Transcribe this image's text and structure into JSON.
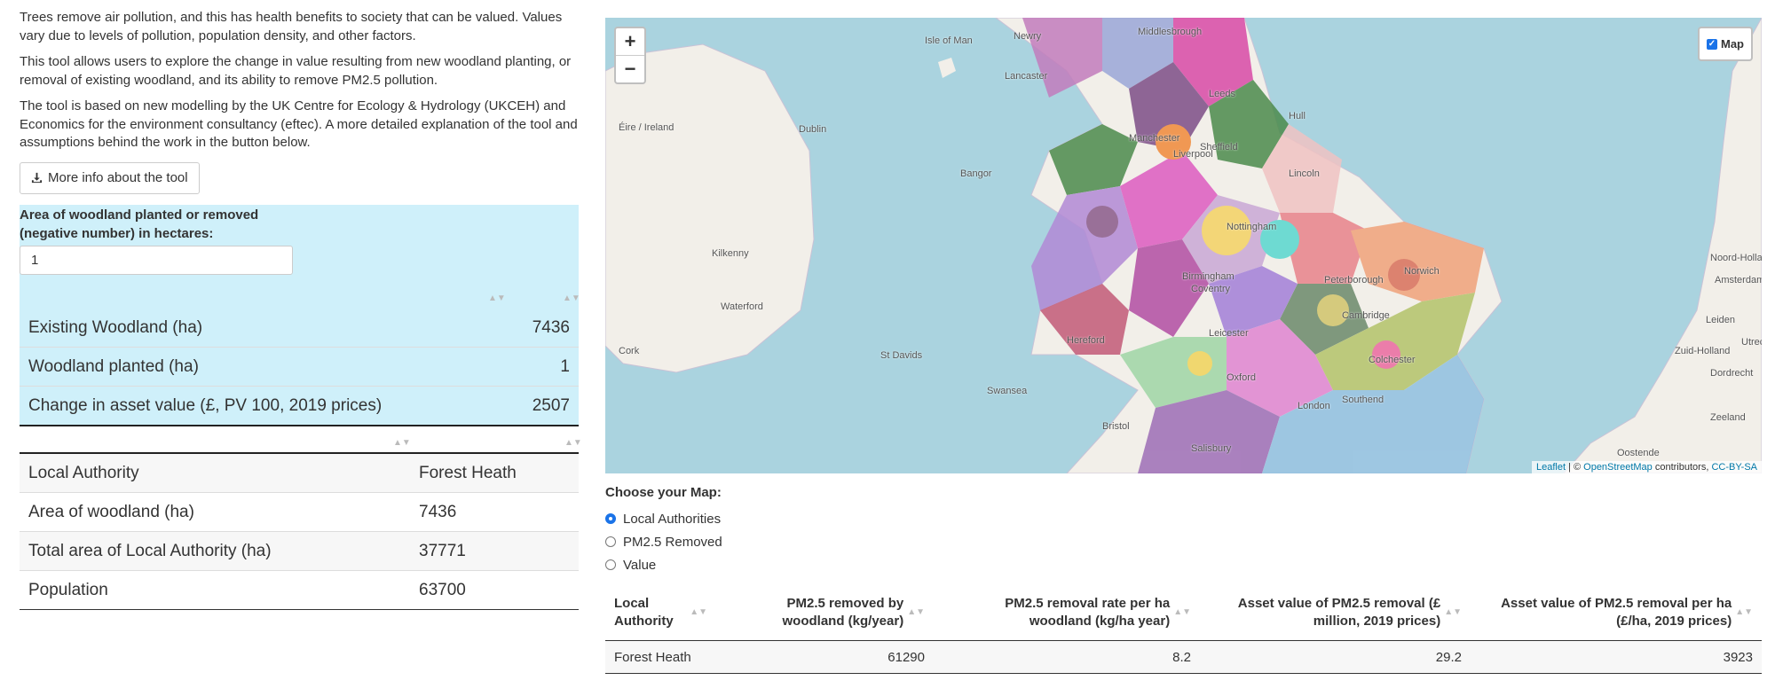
{
  "intro": {
    "p1": "Trees remove air pollution, and this has health benefits to society that can be valued. Values vary due to levels of pollution, population density, and other factors.",
    "p2": "This tool allows users to explore the change in value resulting from new woodland planting, or removal of existing woodland, and its ability to remove PM2.5 pollution.",
    "p3": "The tool is based on new modelling by the UK Centre for Ecology & Hydrology (UKCEH) and Economics for the environment consultancy (eftec). A more detailed explanation of the tool and assumptions behind the work in the button below.",
    "button_label": "More info about the tool"
  },
  "input": {
    "label": "Area of woodland planted or removed (negative number) in hectares:",
    "value": "1"
  },
  "summary_table": {
    "rows": [
      {
        "label": "Existing Woodland (ha)",
        "value": "7436"
      },
      {
        "label": "Woodland planted (ha)",
        "value": "1"
      },
      {
        "label": "Change in asset value (£, PV 100, 2019 prices)",
        "value": "2507"
      }
    ]
  },
  "authority_table": {
    "rows": [
      {
        "label": "Local Authority",
        "value": "Forest Heath"
      },
      {
        "label": "Area of woodland (ha)",
        "value": "7436"
      },
      {
        "label": "Total area of Local Authority (ha)",
        "value": "37771"
      },
      {
        "label": "Population",
        "value": "63700"
      }
    ]
  },
  "map": {
    "zoom_in": "+",
    "zoom_out": "−",
    "layer_label": "Map",
    "attribution": {
      "leaflet": "Leaflet",
      "sep": " | © ",
      "osm": "OpenStreetMap",
      "contrib": " contributors, ",
      "license": "CC-BY-SA"
    },
    "places": [
      "Isle of Man",
      "Éire / Ireland",
      "Dublin",
      "Kilkenny",
      "Waterford",
      "Cork",
      "St Davids",
      "Swansea",
      "Bristol",
      "Birmingham",
      "Manchester",
      "Liverpool",
      "Leeds",
      "Sheffield",
      "Lincoln",
      "Norwich",
      "Cambridge",
      "Peterborough",
      "Colchester",
      "Oxford",
      "Hereford",
      "Leicester",
      "Nottingham",
      "Coventry",
      "London",
      "Southend",
      "Salisbury",
      "Bangor",
      "Lancaster",
      "Hull",
      "Amsterdam",
      "Leiden",
      "Dordrecht",
      "Zeeland",
      "Oostende",
      "Noord-Holland",
      "Zuid-Holland",
      "Utrecht",
      "Newry",
      "Middlesbrough"
    ],
    "colors": {
      "sea": "#aad3df",
      "land": "#f2efe9"
    }
  },
  "map_chooser": {
    "label": "Choose your Map:",
    "options": [
      {
        "label": "Local Authorities",
        "selected": true
      },
      {
        "label": "PM2.5 Removed",
        "selected": false
      },
      {
        "label": "Value",
        "selected": false
      }
    ]
  },
  "data_table": {
    "headers": [
      "Local Authority",
      "PM2.5 removed by woodland (kg/year)",
      "PM2.5 removal rate per ha woodland (kg/ha year)",
      "Asset value of PM2.5 removal (£ million, 2019 prices)",
      "Asset value of PM2.5 removal per ha (£/ha, 2019 prices)"
    ],
    "row": [
      "Forest Heath",
      "61290",
      "8.2",
      "29.2",
      "3923"
    ]
  }
}
